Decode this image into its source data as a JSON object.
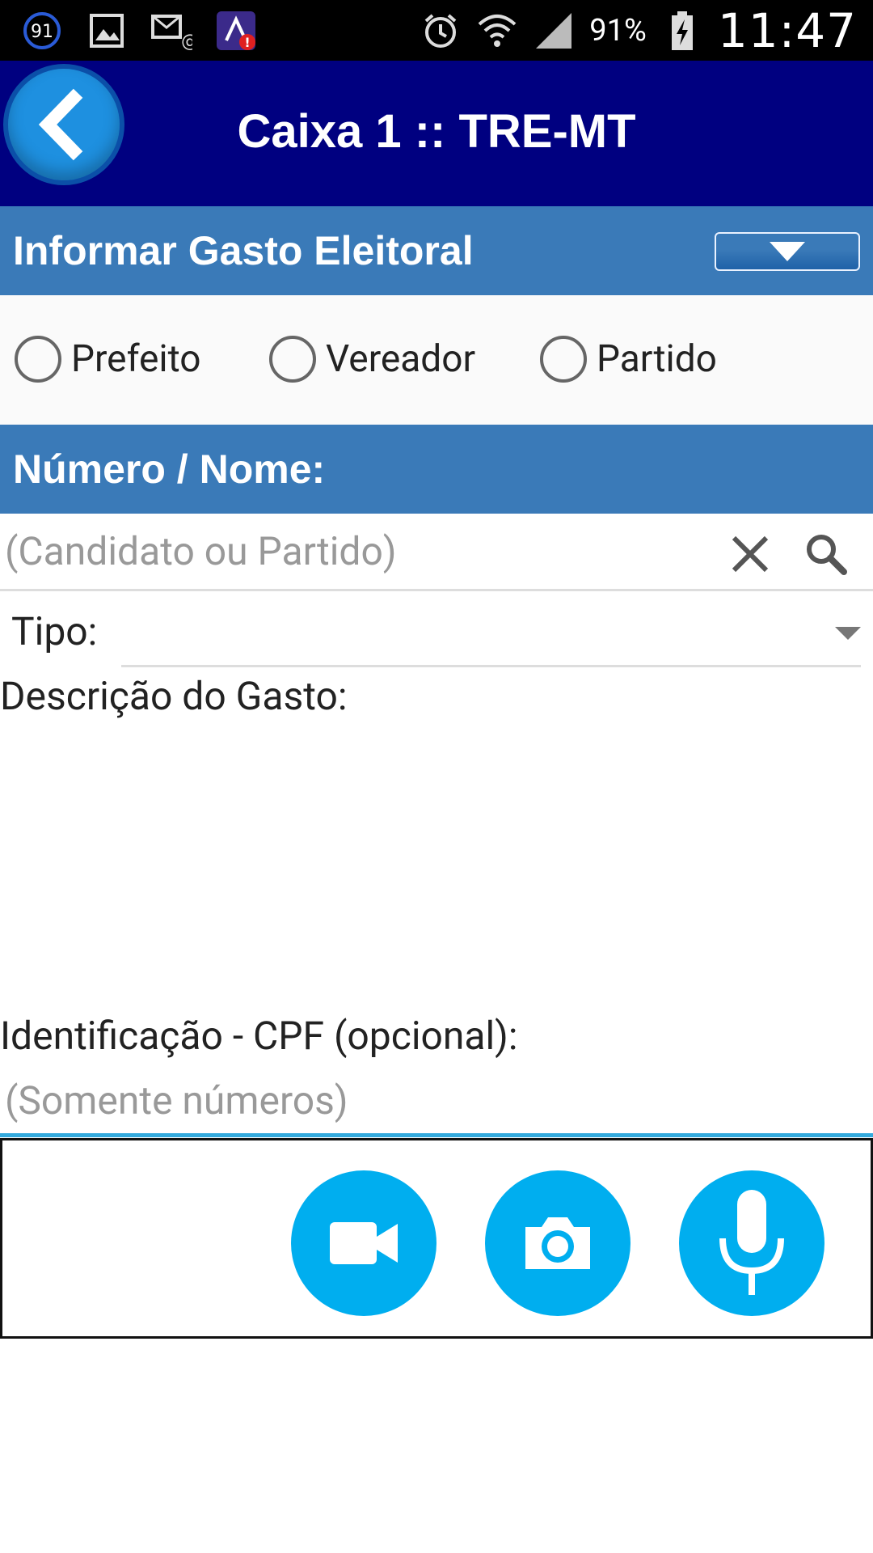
{
  "status_bar": {
    "notification_count": "91",
    "battery": "91%",
    "time": "11:47"
  },
  "header": {
    "title": "Caixa 1 :: TRE-MT"
  },
  "section": {
    "title": "Informar Gasto Eleitoral"
  },
  "radio_options": {
    "prefeito": "Prefeito",
    "vereador": "Vereador",
    "partido": "Partido"
  },
  "search": {
    "label": "Número / Nome:",
    "placeholder": "(Candidato ou Partido)"
  },
  "form": {
    "tipo_label": "Tipo:",
    "tipo_value": "",
    "descricao_label": "Descrição do Gasto:",
    "descricao_value": "",
    "cpf_label": "Identificação - CPF (opcional):",
    "cpf_placeholder": "(Somente números)"
  },
  "colors": {
    "header_bg": "#000080",
    "band_bg": "#3a7ab8",
    "media_button": "#00aeef",
    "focus_line": "#33aadd"
  },
  "icons": [
    "back-arrow-icon",
    "dropdown-triangle-icon",
    "clear-icon",
    "search-icon",
    "video-camera-icon",
    "camera-icon",
    "microphone-icon"
  ]
}
